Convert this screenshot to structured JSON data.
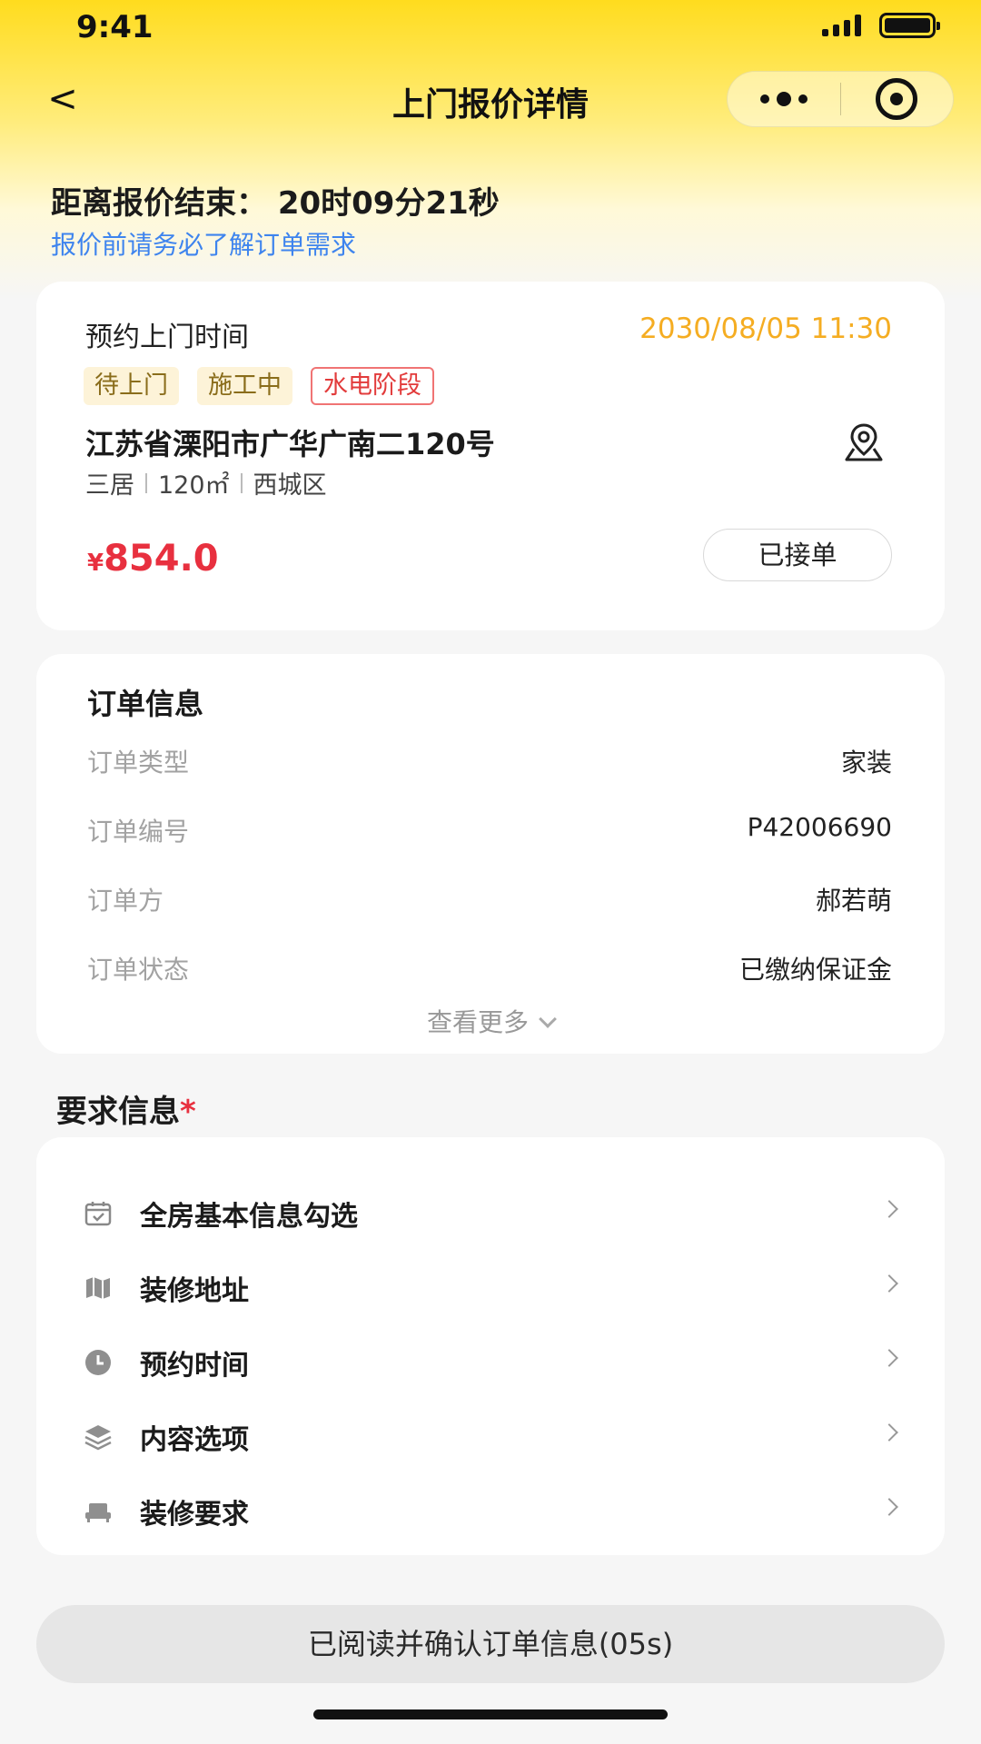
{
  "status_bar": {
    "time": "9:41"
  },
  "nav": {
    "back": "<",
    "title": "上门报价详情"
  },
  "header": {
    "countdown": "距离报价结束： 20时09分21秒",
    "notice": "报价前请务必了解订单需求"
  },
  "appointment": {
    "label": "预约上门时间",
    "time": "2030/08/05 11:30",
    "tags": [
      "待上门",
      "施工中",
      "水电阶段"
    ],
    "address": "江苏省溧阳市广华广南二120号",
    "meta": [
      "三居",
      "120㎡",
      "西城区"
    ],
    "price_symbol": "¥",
    "price": "854.0",
    "accepted_label": "已接单"
  },
  "order_info": {
    "title": "订单信息",
    "rows": [
      {
        "key": "订单类型",
        "value": "家装"
      },
      {
        "key": "订单编号",
        "value": "P42006690"
      },
      {
        "key": "订单方",
        "value": "郝若萌"
      },
      {
        "key": "订单状态",
        "value": "已缴纳保证金"
      }
    ],
    "see_more": "查看更多"
  },
  "requirements": {
    "title": "要求信息",
    "required_mark": "*",
    "items": [
      {
        "label": "全房基本信息勾选",
        "icon": "calendar-check-icon"
      },
      {
        "label": "装修地址",
        "icon": "map-icon"
      },
      {
        "label": "预约时间",
        "icon": "clock-icon"
      },
      {
        "label": "内容选项",
        "icon": "layers-icon"
      },
      {
        "label": "装修要求",
        "icon": "sofa-icon"
      }
    ]
  },
  "footer": {
    "confirm_label": "已阅读并确认订单信息(05s)"
  },
  "colors": {
    "brand_yellow": "#ffdc1e",
    "price_red": "#e8303f",
    "link_blue": "#3e84ee",
    "time_orange": "#f5ad22"
  }
}
